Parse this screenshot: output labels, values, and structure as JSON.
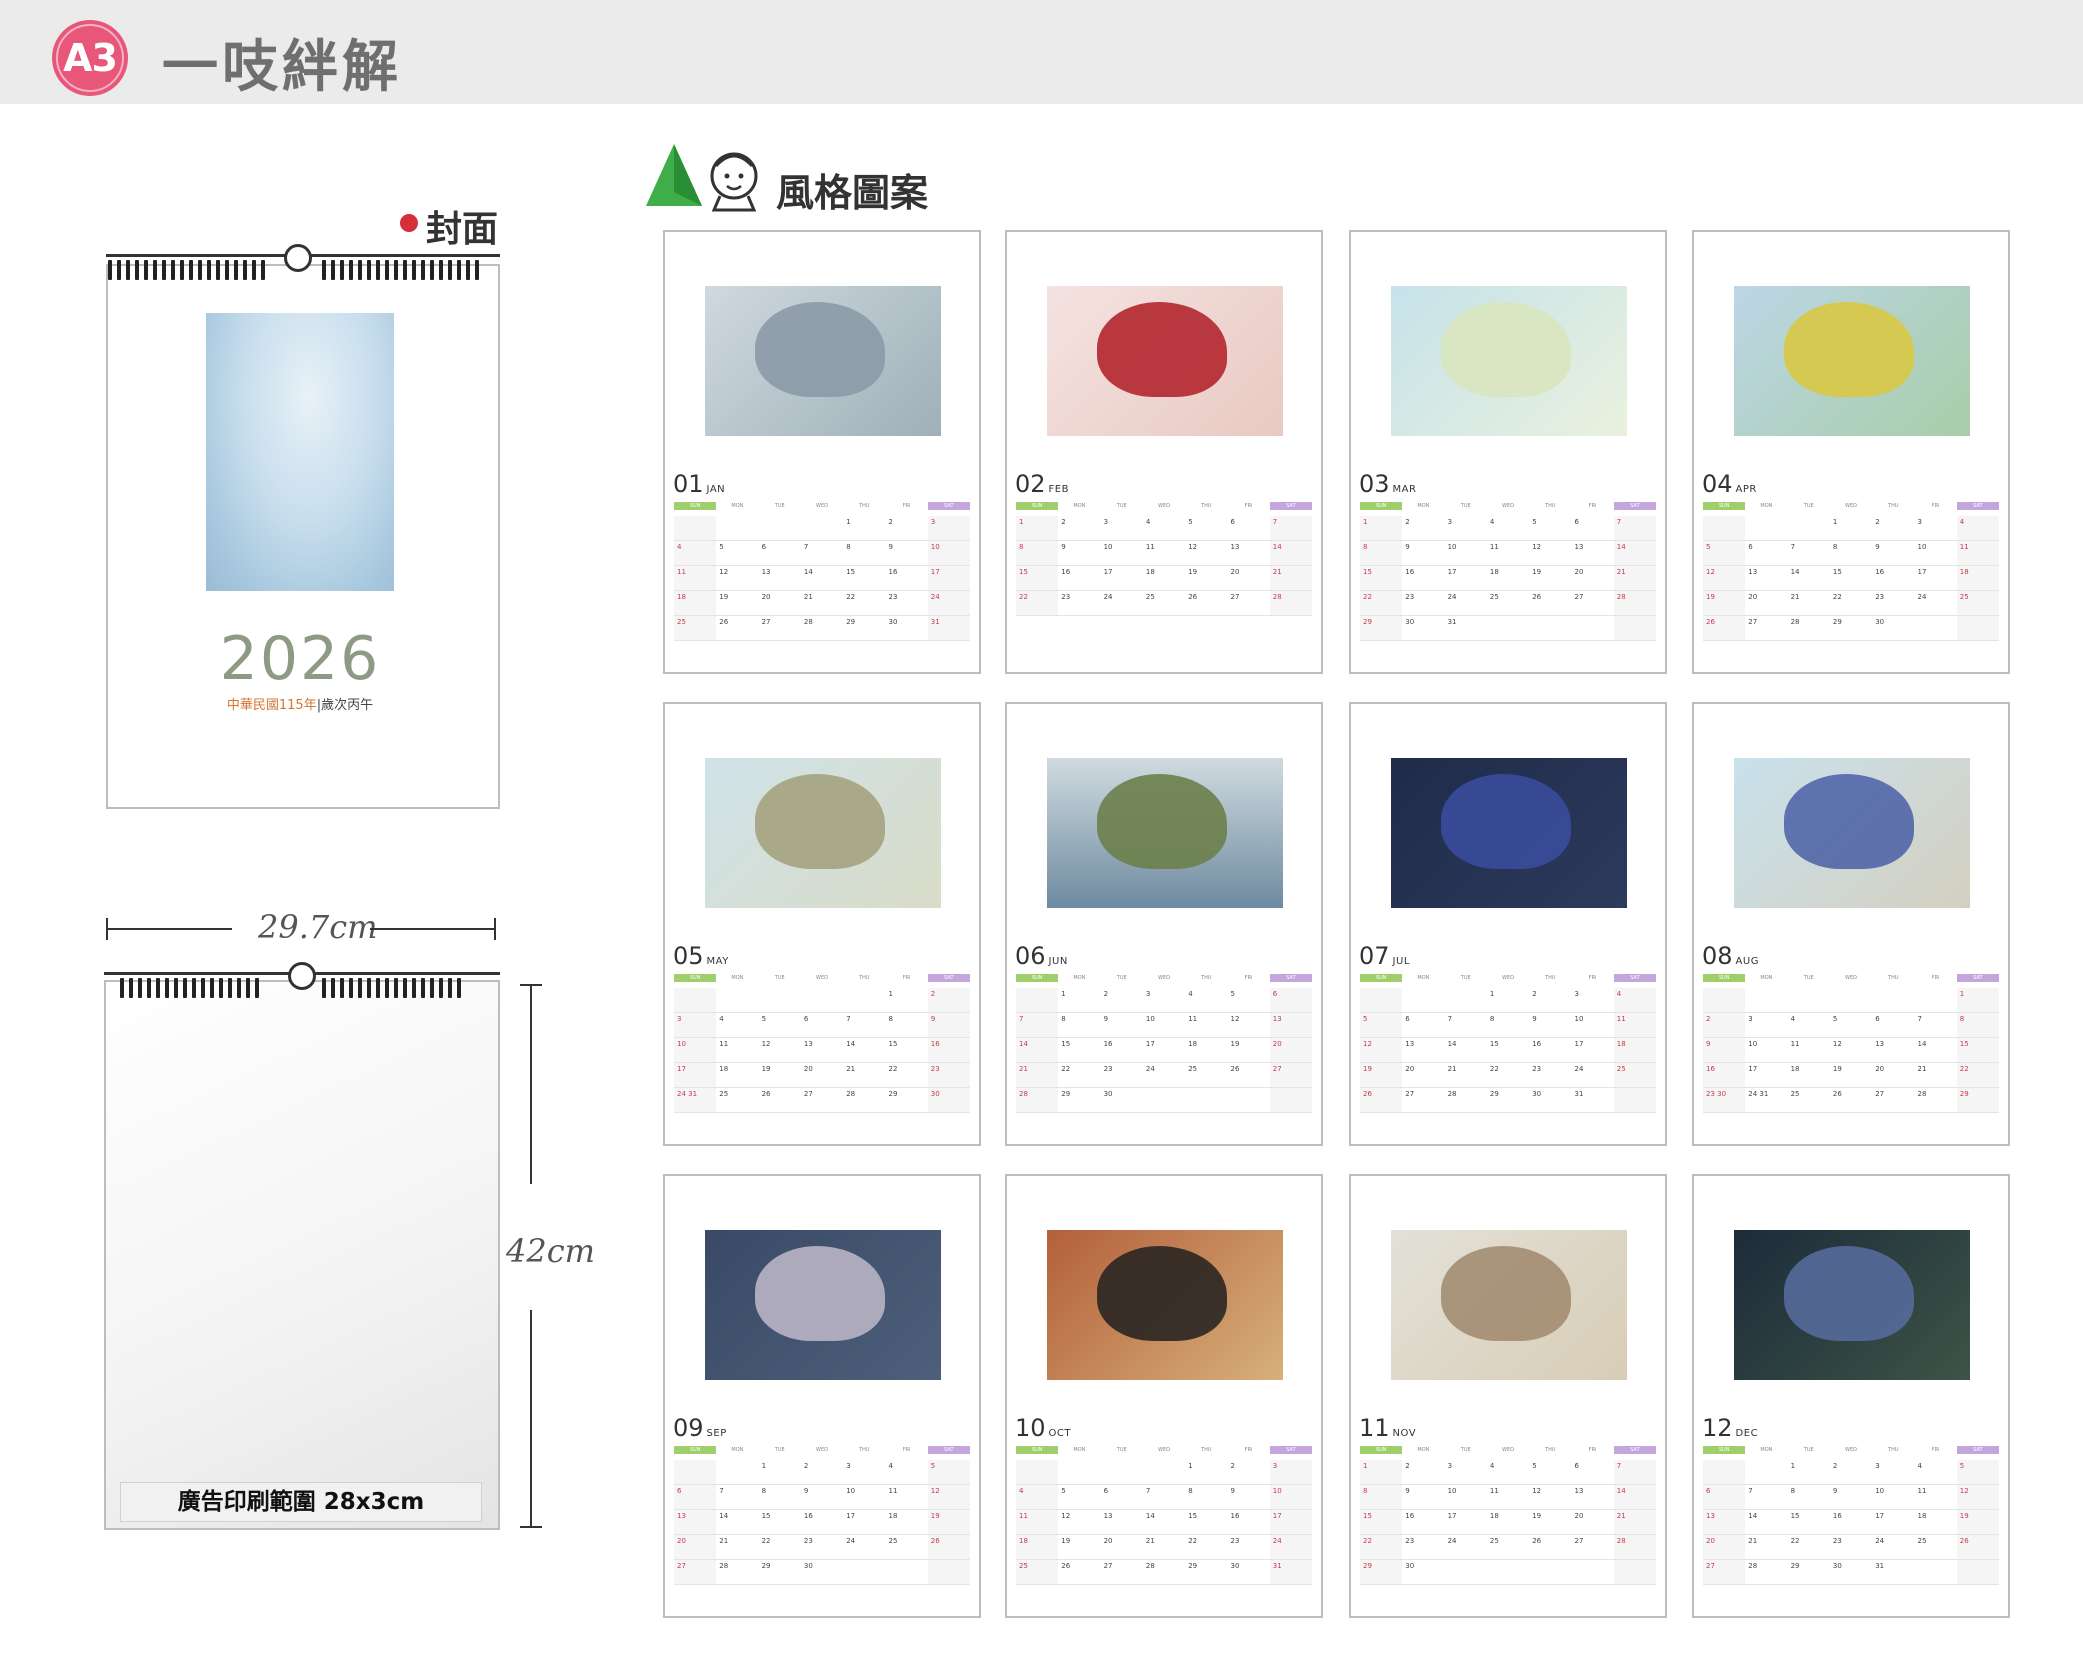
{
  "header": {
    "badge": "A3",
    "model_name": "一吱絆解"
  },
  "cover": {
    "label": "封面",
    "year": "2026",
    "sub_org": "中華民國115年",
    "sub_rest": "|歲次丙午"
  },
  "dimensions": {
    "width": "29.7cm",
    "height": "42cm",
    "ad_area": "廣告印刷範圍 28x3cm"
  },
  "style_section": {
    "title": "風格圖案"
  },
  "colors": {
    "badge": "#e8567a",
    "topbar": "#ebebeb",
    "year": "#8e9a83",
    "sun": "#9fcf6c",
    "sat": "#c4a6dc"
  },
  "months": [
    {
      "num": "01",
      "abbr": "JAN",
      "first": 4,
      "days": 31
    },
    {
      "num": "02",
      "abbr": "FEB",
      "first": 0,
      "days": 28
    },
    {
      "num": "03",
      "abbr": "MAR",
      "first": 0,
      "days": 31
    },
    {
      "num": "04",
      "abbr": "APR",
      "first": 3,
      "days": 30
    },
    {
      "num": "05",
      "abbr": "MAY",
      "first": 5,
      "days": 31
    },
    {
      "num": "06",
      "abbr": "JUN",
      "first": 1,
      "days": 30
    },
    {
      "num": "07",
      "abbr": "JUL",
      "first": 3,
      "days": 31
    },
    {
      "num": "08",
      "abbr": "AUG",
      "first": 6,
      "days": 31
    },
    {
      "num": "09",
      "abbr": "SEP",
      "first": 2,
      "days": 30
    },
    {
      "num": "10",
      "abbr": "OCT",
      "first": 4,
      "days": 31
    },
    {
      "num": "11",
      "abbr": "NOV",
      "first": 0,
      "days": 30
    },
    {
      "num": "12",
      "abbr": "DEC",
      "first": 2,
      "days": 31
    }
  ],
  "weekday_headers": [
    "SUN",
    "MON",
    "TUE",
    "WED",
    "THU",
    "FRI",
    "SAT"
  ]
}
